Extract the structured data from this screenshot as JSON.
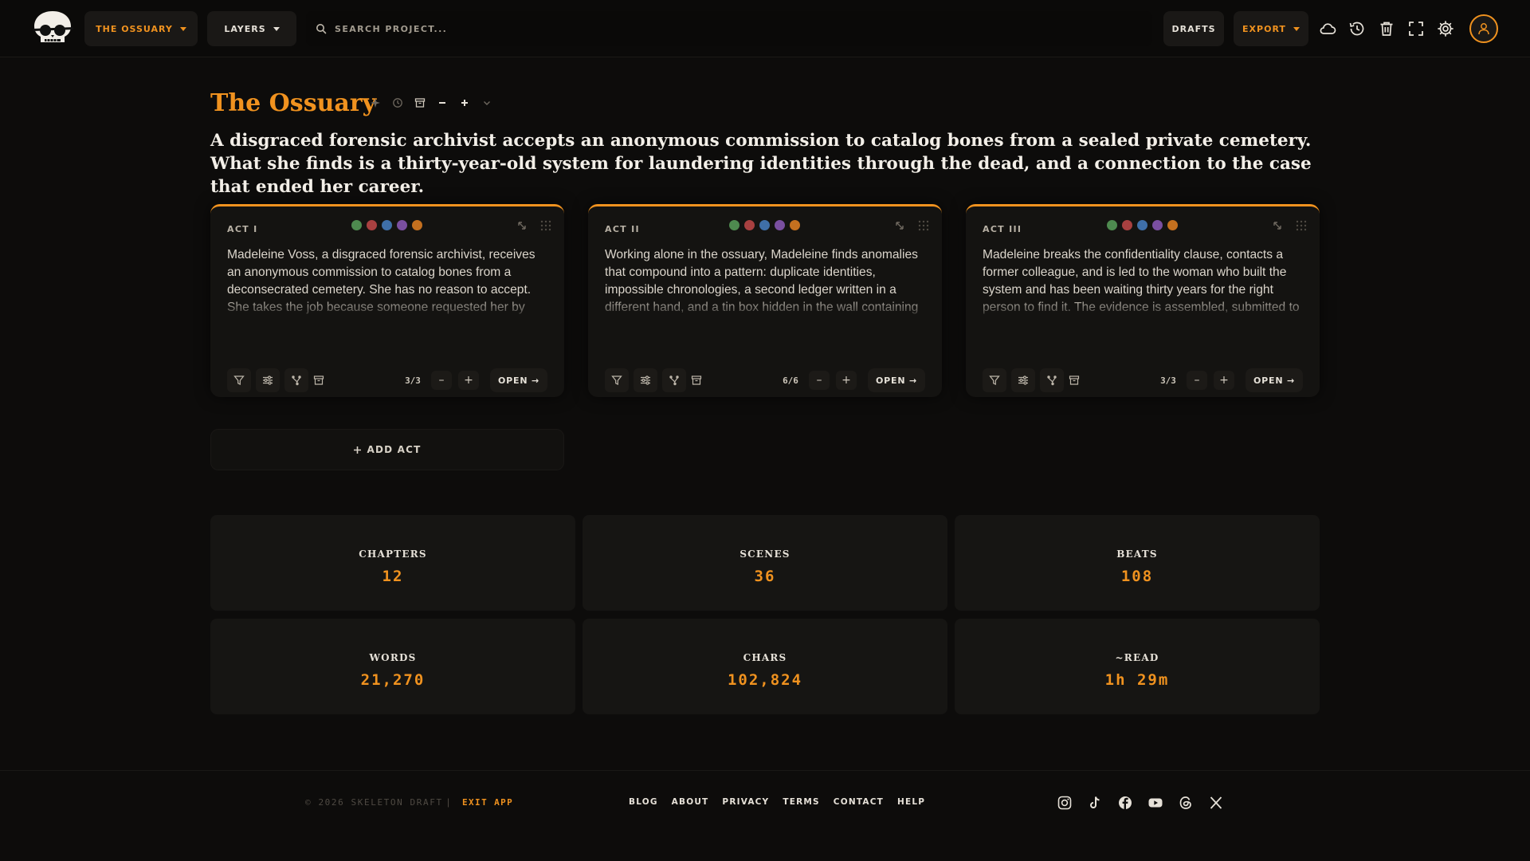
{
  "topbar": {
    "project_label": "THE OSSUARY",
    "layers_label": "LAYERS",
    "search_placeholder": "SEARCH PROJECT...",
    "drafts_label": "DRAFTS",
    "export_label": "EXPORT",
    "icons": [
      "cloud-icon",
      "history-icon",
      "trash-icon",
      "fullscreen-icon",
      "gear-icon",
      "user-icon"
    ]
  },
  "header": {
    "title": "The Ossuary",
    "logline": "A disgraced forensic archivist accepts an anonymous commission to catalog bones from a sealed private cemetery. What she finds is a thirty-year-old system for laundering identities through the dead, and a connection to the case that ended her career."
  },
  "acts": [
    {
      "label": "ACT I",
      "text": "Madeleine Voss, a disgraced forensic archivist, receives an anonymous commission to catalog bones from a deconsecrated cemetery. She has no reason to accept. She takes the job because someone requested her by name from a dead man's estate, and that detail, more than the money, will not leave her alone.",
      "count": "3/3",
      "open_label": "OPEN →"
    },
    {
      "label": "ACT II",
      "text": "Working alone in the ossuary, Madeleine finds anomalies that compound into a pattern: duplicate identities, impossible chronologies, a second ledger written in a different hand, and a tin box hidden in the wall containing photographs that connect the dead to the living. The more she catalogs, the clearer it",
      "count": "6/6",
      "open_label": "OPEN →"
    },
    {
      "label": "ACT III",
      "text": "Madeleine breaks the confidentiality clause, contacts a former colleague, and is led to the woman who built the system and has been waiting thirty years for the right person to find it. The evidence is assembled, submitted to three parties simultaneously, and the investigation begins. Madeleine does not feel vindicated. She feels",
      "count": "3/3",
      "open_label": "OPEN →"
    }
  ],
  "act_dot_colors": [
    "#4e8a4f",
    "#a84040",
    "#3f6fa8",
    "#7a4fa0",
    "#c4701f"
  ],
  "step_minus": "–",
  "step_plus": "+",
  "add_act_label": "ADD ACT",
  "stats": [
    {
      "label": "CHAPTERS",
      "value": "12"
    },
    {
      "label": "SCENES",
      "value": "36"
    },
    {
      "label": "BEATS",
      "value": "108"
    },
    {
      "label": "WORDS",
      "value": "21,270"
    },
    {
      "label": "CHARS",
      "value": "102,824"
    },
    {
      "label": "~READ",
      "value": "1h 29m"
    }
  ],
  "footer": {
    "copyright": "© 2026 SKELETON DRAFT",
    "separator": "|",
    "exit_label": "EXIT APP",
    "links": [
      "BLOG",
      "ABOUT",
      "PRIVACY",
      "TERMS",
      "CONTACT",
      "HELP"
    ],
    "social": [
      "instagram-icon",
      "tiktok-icon",
      "facebook-icon",
      "youtube-icon",
      "threads-icon",
      "x-icon"
    ]
  },
  "colors": {
    "accent": "#f0921f",
    "background": "#0d0c0b",
    "card": "#141311"
  }
}
